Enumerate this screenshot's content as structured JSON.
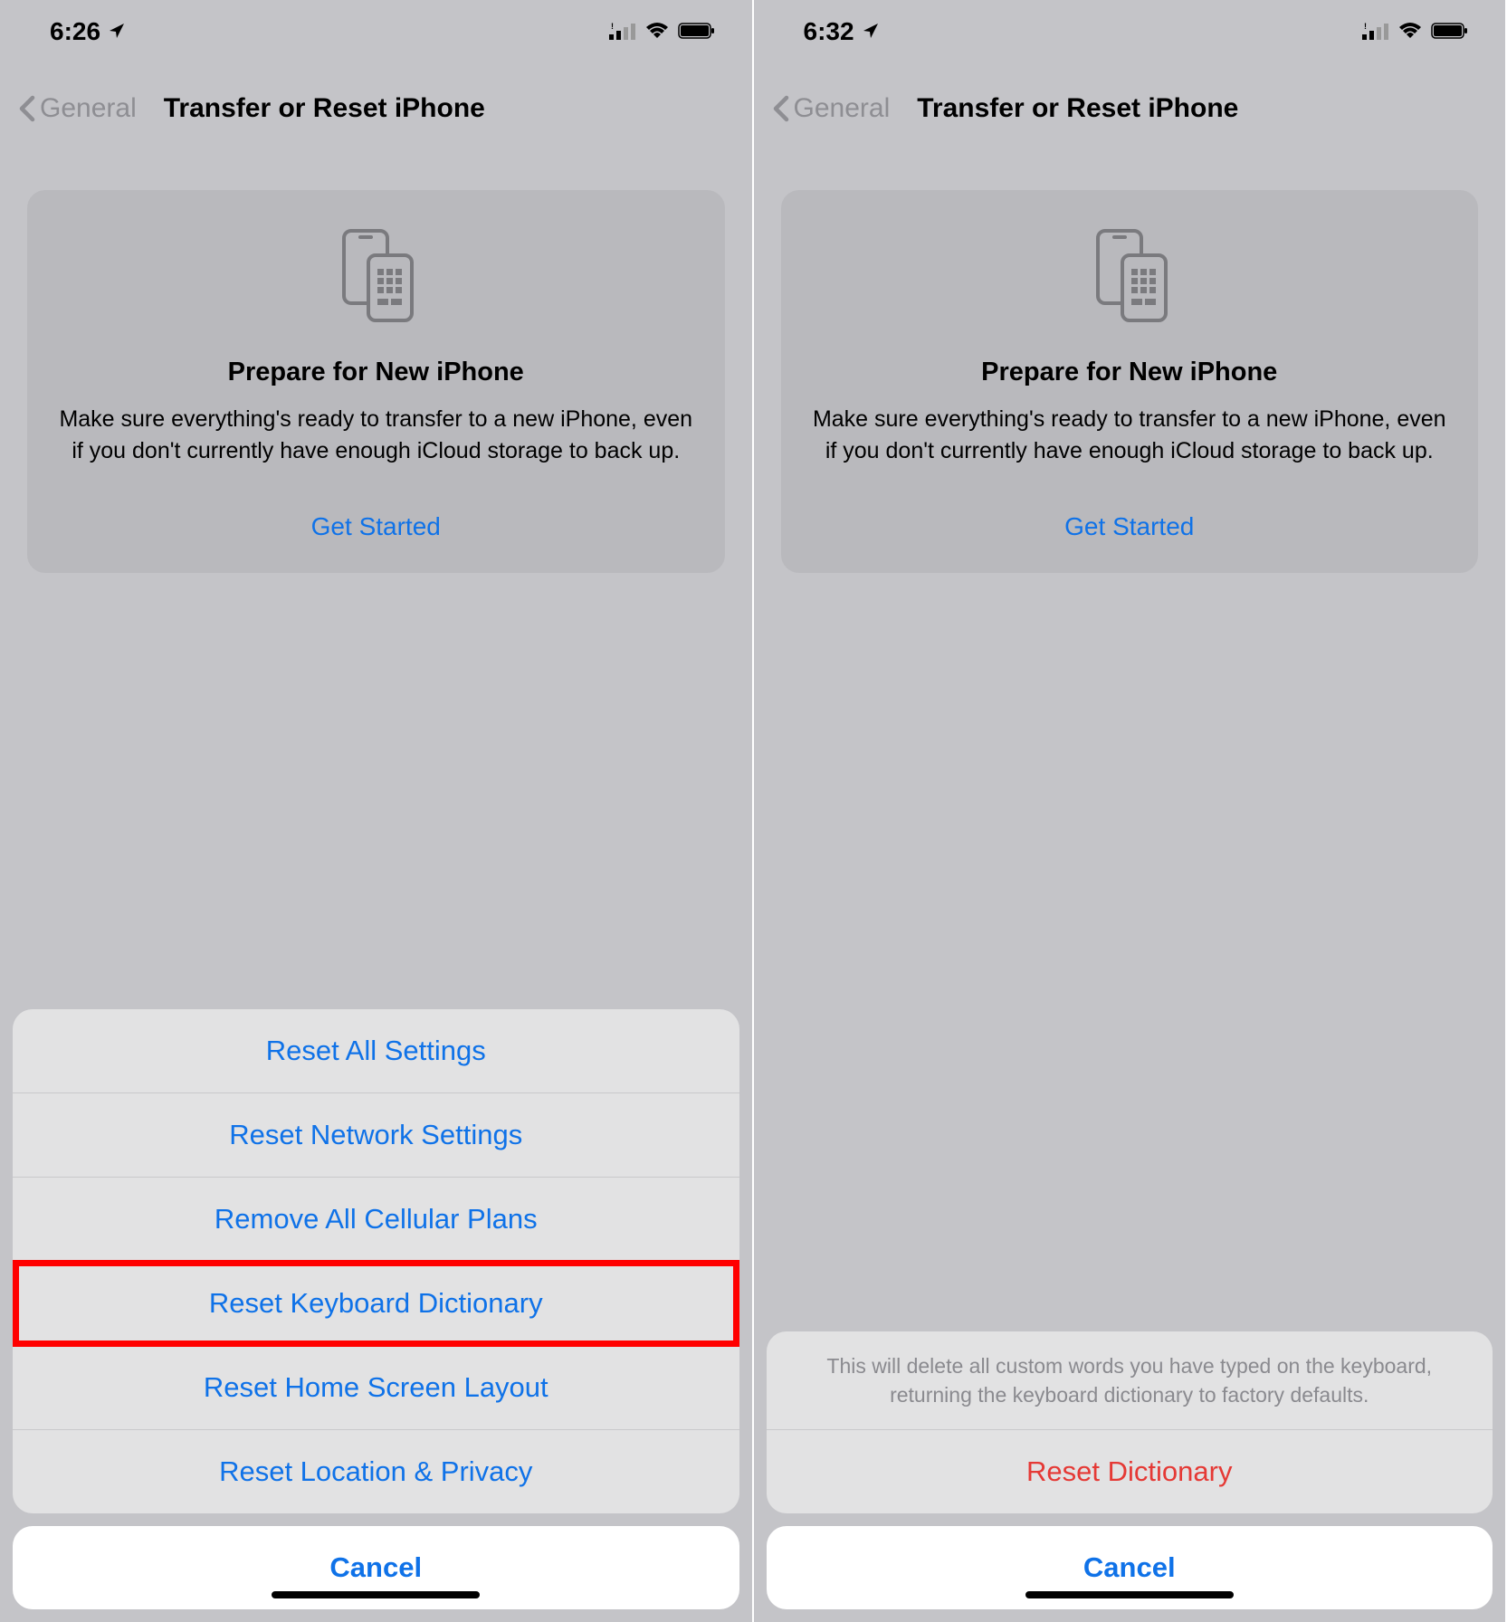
{
  "left": {
    "status": {
      "time": "6:26",
      "location_icon": "location"
    },
    "nav": {
      "back_label": "General",
      "title": "Transfer or Reset iPhone"
    },
    "prepare": {
      "title": "Prepare for New iPhone",
      "desc": "Make sure everything's ready to transfer to a new iPhone, even if you don't currently have enough iCloud storage to back up.",
      "button": "Get Started"
    },
    "sheet": {
      "items": [
        "Reset All Settings",
        "Reset Network Settings",
        "Remove All Cellular Plans",
        "Reset Keyboard Dictionary",
        "Reset Home Screen Layout",
        "Reset Location & Privacy"
      ],
      "cancel": "Cancel"
    }
  },
  "right": {
    "status": {
      "time": "6:32",
      "location_icon": "location"
    },
    "nav": {
      "back_label": "General",
      "title": "Transfer or Reset iPhone"
    },
    "prepare": {
      "title": "Prepare for New iPhone",
      "desc": "Make sure everything's ready to transfer to a new iPhone, even if you don't currently have enough iCloud storage to back up.",
      "button": "Get Started"
    },
    "sheet": {
      "message": "This will delete all custom words you have typed on the keyboard, returning the keyboard dictionary to factory defaults.",
      "action": "Reset Dictionary",
      "cancel": "Cancel"
    }
  }
}
